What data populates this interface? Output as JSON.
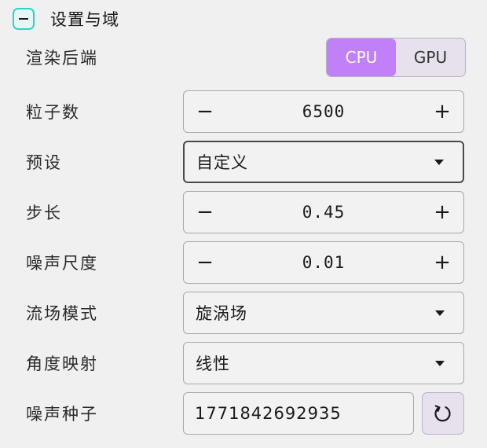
{
  "section": {
    "title": "设置与域",
    "collapse_icon": "minus-icon"
  },
  "backend": {
    "label": "渲染后端",
    "options": [
      "CPU",
      "GPU"
    ],
    "selected": "CPU",
    "accent_color": "#bf80f8"
  },
  "particles": {
    "label": "粒子数",
    "value": "6500",
    "decrement": "−",
    "increment": "+"
  },
  "preset": {
    "label": "预设",
    "value": "自定义"
  },
  "step": {
    "label": "步长",
    "value": "0.45",
    "decrement": "−",
    "increment": "+"
  },
  "noise_scale": {
    "label": "噪声尺度",
    "value": "0.01",
    "decrement": "−",
    "increment": "+"
  },
  "field_mode": {
    "label": "流场模式",
    "value": "旋涡场"
  },
  "angle_mapping": {
    "label": "角度映射",
    "value": "线性"
  },
  "noise_seed": {
    "label": "噪声种子",
    "value": "1771842692935",
    "refresh_icon": "refresh-icon"
  }
}
